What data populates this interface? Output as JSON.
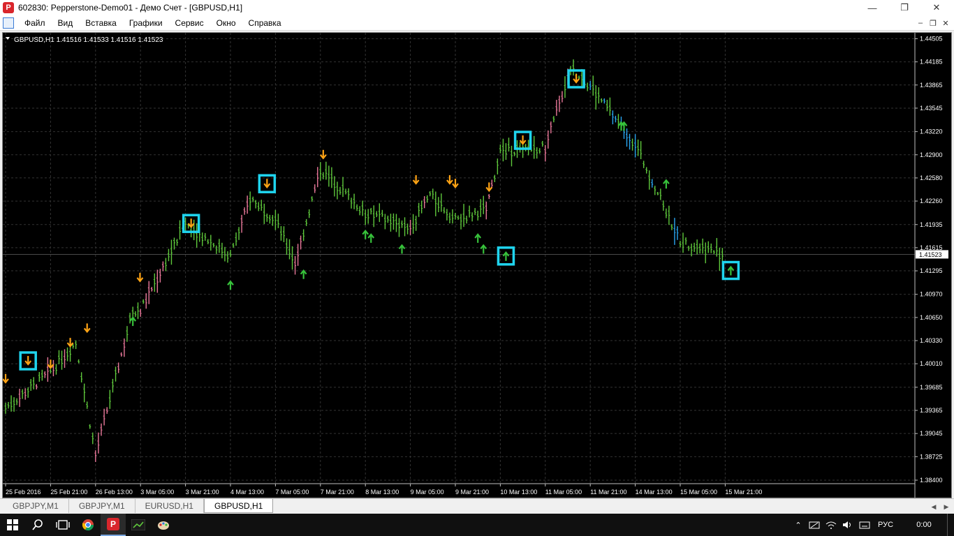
{
  "window": {
    "title": "602830: Pepperstone-Demo01 - Демо Счет - [GBPUSD,H1]",
    "minimize": "—",
    "maximize": "❐",
    "close": "✕"
  },
  "menu": [
    "Файл",
    "Вид",
    "Вставка",
    "Графики",
    "Сервис",
    "Окно",
    "Справка"
  ],
  "chart": {
    "header": "GBPUSD,H1  1.41516 1.41533 1.41516 1.41523",
    "current_price": "1.41523",
    "price_ticks": [
      "1.44505",
      "1.44185",
      "1.43865",
      "1.43545",
      "1.43220",
      "1.42900",
      "1.42580",
      "1.42260",
      "1.41935",
      "1.41615",
      "1.41295",
      "1.40970",
      "1.40650",
      "1.40330",
      "1.40010",
      "1.39685",
      "1.39365",
      "1.39045",
      "1.38725",
      "1.38400"
    ],
    "time_ticks": [
      "25 Feb 2016",
      "25 Feb 21:00",
      "26 Feb 13:00",
      "3 Mar 05:00",
      "3 Mar 21:00",
      "4 Mar 13:00",
      "7 Mar 05:00",
      "7 Mar 21:00",
      "8 Mar 13:00",
      "9 Mar 05:00",
      "9 Mar 21:00",
      "10 Mar 13:00",
      "11 Mar 05:00",
      "11 Mar 21:00",
      "14 Mar 13:00",
      "15 Mar 05:00",
      "15 Mar 21:00"
    ],
    "colors": {
      "background": "#000000",
      "bar": "#5fc83c",
      "bar_bull": "#e9789a",
      "bar_bear": "#2aa6f0",
      "arrow_up": "#37c23b",
      "arrow_down": "#ffa314",
      "highlight": "#1fd4ee",
      "grid": "#333333",
      "price_line": "#777777"
    }
  },
  "chart_data": {
    "type": "ohlc",
    "symbol": "GBPUSD",
    "timeframe": "H1",
    "ohlc_last": {
      "open": 1.41516,
      "high": 1.41533,
      "low": 1.41516,
      "close": 1.41523
    },
    "ylim": [
      1.384,
      1.445
    ],
    "grid": true,
    "close_path": [
      {
        "t": "25 Feb 2016",
        "price": 1.394
      },
      {
        "t": "25 Feb 21:00",
        "price": 1.399
      },
      {
        "t": "26 Feb 06:00",
        "price": 1.403
      },
      {
        "t": "26 Feb 13:00",
        "price": 1.3875
      },
      {
        "t": "2 Mar 14:00",
        "price": 1.4075
      },
      {
        "t": "3 Mar 05:00",
        "price": 1.4075
      },
      {
        "t": "3 Mar 21:00",
        "price": 1.4195
      },
      {
        "t": "4 Mar 13:00",
        "price": 1.415
      },
      {
        "t": "4 Mar 20:00",
        "price": 1.423
      },
      {
        "t": "7 Mar 05:00",
        "price": 1.42
      },
      {
        "t": "7 Mar 12:00",
        "price": 1.414
      },
      {
        "t": "7 Mar 21:00",
        "price": 1.427
      },
      {
        "t": "8 Mar 13:00",
        "price": 1.421
      },
      {
        "t": "9 Mar 05:00",
        "price": 1.419
      },
      {
        "t": "9 Mar 12:00",
        "price": 1.4235
      },
      {
        "t": "9 Mar 21:00",
        "price": 1.42
      },
      {
        "t": "10 Mar 08:00",
        "price": 1.4215
      },
      {
        "t": "10 Mar 13:00",
        "price": 1.4295
      },
      {
        "t": "11 Mar 05:00",
        "price": 1.43
      },
      {
        "t": "11 Mar 14:00",
        "price": 1.441
      },
      {
        "t": "11 Mar 21:00",
        "price": 1.4385
      },
      {
        "t": "14 Mar 13:00",
        "price": 1.4305
      },
      {
        "t": "15 Mar 05:00",
        "price": 1.417
      },
      {
        "t": "15 Mar 21:00",
        "price": 1.4152
      }
    ],
    "signals": [
      {
        "dir": "sell",
        "t": "25 Feb 2016",
        "price": 1.398,
        "boxed": false
      },
      {
        "dir": "sell",
        "t": "25 Feb 13:00",
        "price": 1.4005,
        "boxed": true
      },
      {
        "dir": "sell",
        "t": "25 Feb 21:00",
        "price": 1.4,
        "boxed": false
      },
      {
        "dir": "sell",
        "t": "26 Feb 04:00",
        "price": 1.403,
        "boxed": false
      },
      {
        "dir": "sell",
        "t": "26 Feb 10:00",
        "price": 1.405,
        "boxed": false
      },
      {
        "dir": "buy",
        "t": "2 Mar 14:00",
        "price": 1.406,
        "boxed": false
      },
      {
        "dir": "sell",
        "t": "3 Mar 04:00",
        "price": 1.412,
        "boxed": false
      },
      {
        "dir": "sell",
        "t": "3 Mar 23:00",
        "price": 1.4195,
        "boxed": true
      },
      {
        "dir": "buy",
        "t": "4 Mar 13:00",
        "price": 1.411,
        "boxed": false
      },
      {
        "dir": "sell",
        "t": "7 Mar 02:00",
        "price": 1.425,
        "boxed": true
      },
      {
        "dir": "buy",
        "t": "7 Mar 15:00",
        "price": 1.4125,
        "boxed": false
      },
      {
        "dir": "sell",
        "t": "7 Mar 22:00",
        "price": 1.429,
        "boxed": false
      },
      {
        "dir": "buy",
        "t": "8 Mar 13:00",
        "price": 1.418,
        "boxed": false
      },
      {
        "dir": "buy",
        "t": "8 Mar 15:00",
        "price": 1.4175,
        "boxed": false
      },
      {
        "dir": "buy",
        "t": "9 Mar 02:00",
        "price": 1.416,
        "boxed": false
      },
      {
        "dir": "sell",
        "t": "9 Mar 07:00",
        "price": 1.4255,
        "boxed": false
      },
      {
        "dir": "sell",
        "t": "9 Mar 19:00",
        "price": 1.4255,
        "boxed": false
      },
      {
        "dir": "sell",
        "t": "9 Mar 21:00",
        "price": 1.425,
        "boxed": false
      },
      {
        "dir": "buy",
        "t": "10 Mar 05:00",
        "price": 1.4175,
        "boxed": false
      },
      {
        "dir": "buy",
        "t": "10 Mar 07:00",
        "price": 1.416,
        "boxed": false
      },
      {
        "dir": "sell",
        "t": "10 Mar 09:00",
        "price": 1.4245,
        "boxed": false
      },
      {
        "dir": "buy",
        "t": "10 Mar 15:00",
        "price": 1.415,
        "boxed": true
      },
      {
        "dir": "sell",
        "t": "10 Mar 21:00",
        "price": 1.431,
        "boxed": true
      },
      {
        "dir": "sell",
        "t": "11 Mar 16:00",
        "price": 1.4395,
        "boxed": true
      },
      {
        "dir": "buy",
        "t": "14 Mar 08:00",
        "price": 1.433,
        "boxed": false
      },
      {
        "dir": "buy",
        "t": "14 Mar 09:00",
        "price": 1.433,
        "boxed": false
      },
      {
        "dir": "buy",
        "t": "15 Mar 00:00",
        "price": 1.425,
        "boxed": false
      },
      {
        "dir": "buy",
        "t": "15 Mar 23:00",
        "price": 1.413,
        "boxed": true
      }
    ]
  },
  "tabs": [
    {
      "label": "GBPJPY,M1",
      "active": false
    },
    {
      "label": "GBPJPY,M1",
      "active": false
    },
    {
      "label": "EURUSD,H1",
      "active": false
    },
    {
      "label": "GBPUSD,H1",
      "active": true
    }
  ],
  "taskbar": {
    "lang": "РУС",
    "time": "0:00"
  }
}
